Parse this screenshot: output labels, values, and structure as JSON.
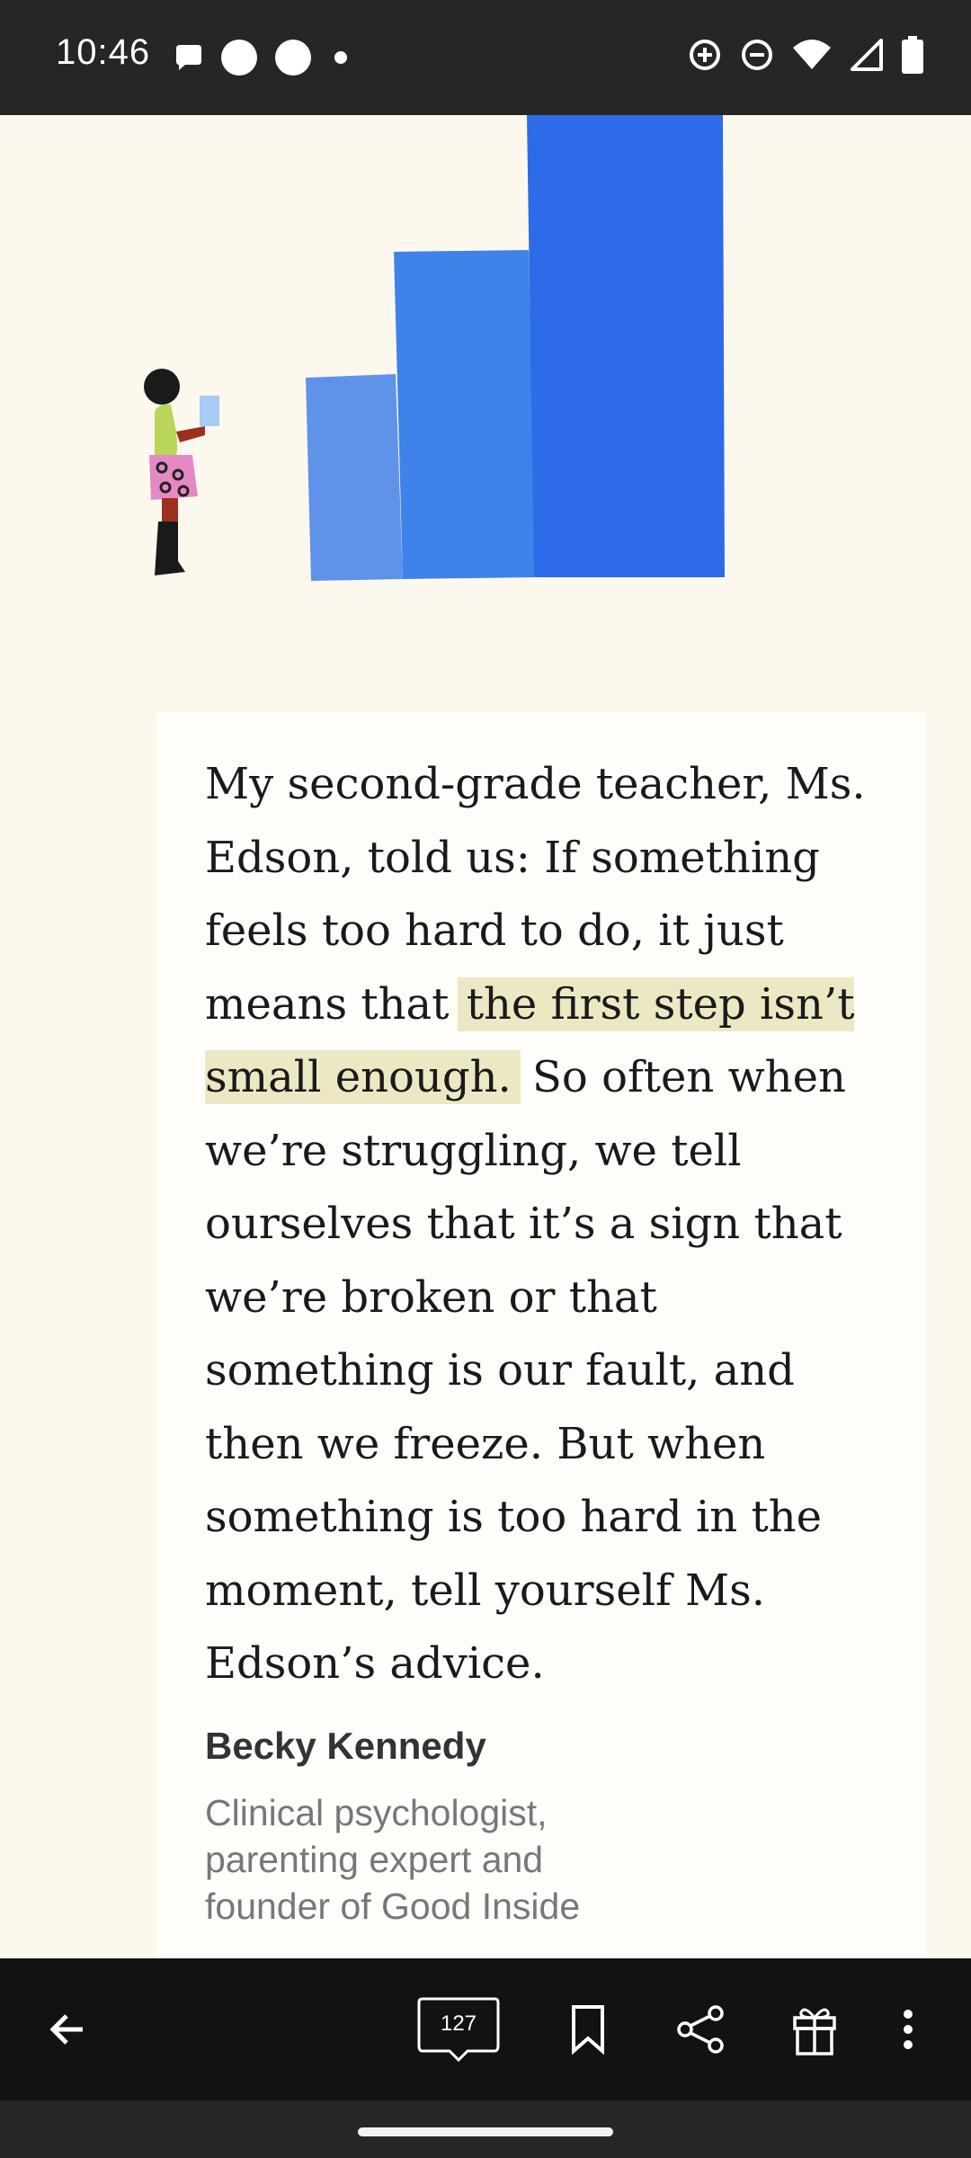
{
  "status_bar": {
    "time": "10:46",
    "left_icons": [
      "chat-bubble-icon",
      "circle-icon",
      "circle-icon",
      "dot-icon"
    ],
    "right_icons": [
      "data-saver-icon",
      "do-not-disturb-icon",
      "wifi-icon",
      "signal-icon",
      "battery-icon"
    ]
  },
  "illustration": {
    "description_icon": "woman-with-bar-chart-illustration",
    "colors": {
      "bar_small": "#5f93ea",
      "bar_medium": "#3f82ea",
      "bar_large": "#2d6be8"
    }
  },
  "quote": {
    "before_highlight": "My second-grade teacher, Ms. Edson, told us:  If something feels too hard to do, it just means that ",
    "highlight": "the first step isn’t small enough.",
    "after_highlight": " So often when we’re struggling, we tell ourselves that it’s a sign that we’re broken or that something is our fault, and then we freeze. But when something is too hard in the moment, tell yourself Ms. Edson’s advice.",
    "author": "Becky Kennedy",
    "author_title": "Clinical psychologist, parenting expert and founder of Good Inside"
  },
  "toolbar": {
    "back_icon": "arrow-left-icon",
    "comment_count": "127",
    "icons": [
      "comment-icon",
      "bookmark-icon",
      "share-icon",
      "gift-icon",
      "more-vert-icon"
    ]
  },
  "colors": {
    "background": "#fdf8ee",
    "card": "#fffdf9",
    "highlight": "#ede8c4",
    "toolbar": "#121212",
    "status_bar": "#262626"
  }
}
